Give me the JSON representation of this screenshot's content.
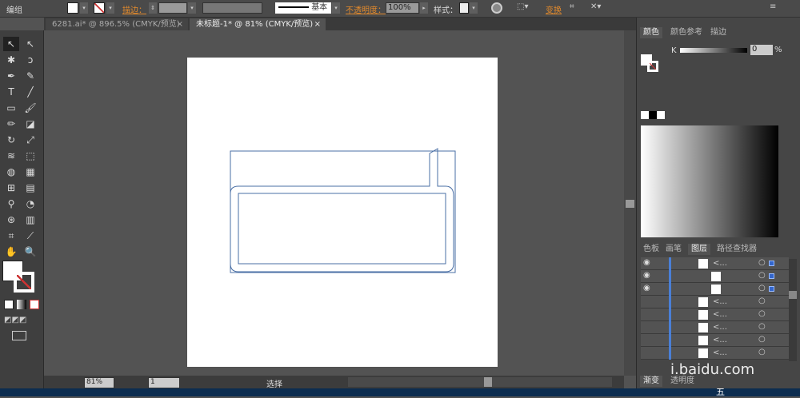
{
  "control_bar": {
    "selection": "编组",
    "stroke_label": "描边：",
    "stroke_style": "基本",
    "opacity_label": "不透明度：",
    "opacity": "100%",
    "style_label": "样式：",
    "transform_label": "变换"
  },
  "tabs": [
    {
      "label": "6281.ai* @ 896.5% (CMYK/预览)",
      "close": "×"
    },
    {
      "label": "未标题-1* @ 81% (CMYK/预览)",
      "close": "×",
      "active": true
    }
  ],
  "color_panel": {
    "tabs": [
      "颜色",
      "颜色参考",
      "描边"
    ],
    "slider_label": "K",
    "value": "0",
    "unit": "%"
  },
  "layers_panel": {
    "tabs": [
      "色板",
      "画笔",
      "图层",
      "路径查找器"
    ],
    "row_label": "<...",
    "bottom_tabs": [
      "渐变",
      "透明度"
    ]
  },
  "status": {
    "zoom": "81%",
    "page": "1",
    "tool": "选择"
  },
  "watermark": "i.baidu.com",
  "taskbar": {
    "ime": "五"
  },
  "colors": {
    "accent": "#e28a2c",
    "path": "#4a6fa5",
    "layer_bar": "#4a7fd6"
  }
}
